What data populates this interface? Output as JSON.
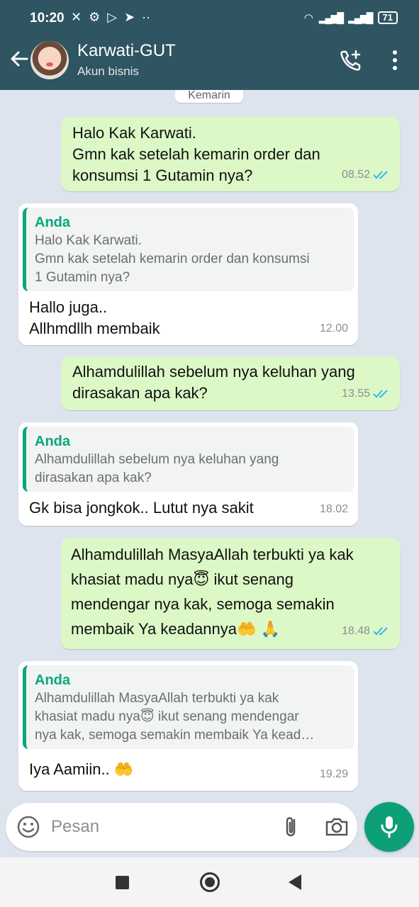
{
  "status_bar": {
    "time": "10:20",
    "battery": "71"
  },
  "header": {
    "title": "Karwati-GUT",
    "subtitle": "Akun bisnis"
  },
  "date_chip": "Kemarin",
  "messages": [
    {
      "direction": "out",
      "text": "Halo Kak Karwati.\nGmn kak setelah kemarin order dan\nkonsumsi 1 Gutamin nya?",
      "time": "08.52",
      "status": "read"
    },
    {
      "direction": "in",
      "quote_author": "Anda",
      "quote_text": "Halo Kak Karwati.\nGmn kak setelah kemarin order dan konsumsi\n1 Gutamin nya?",
      "text": "Hallo juga..\nAllhmdllh membaik",
      "time": "12.00"
    },
    {
      "direction": "out",
      "text": "Alhamdulillah sebelum nya keluhan yang\ndirasakan apa kak?",
      "time": "13.55",
      "status": "read"
    },
    {
      "direction": "in",
      "quote_author": "Anda",
      "quote_text": "Alhamdulillah sebelum nya keluhan yang\ndirasakan apa kak?",
      "text": "Gk bisa jongkok.. Lutut nya sakit",
      "time": "18.02"
    },
    {
      "direction": "out",
      "text": "Alhamdulillah MasyaAllah terbukti ya kak\nkhasiat madu nya😇 ikut senang\nmendengar nya kak, semoga semakin\nmembaik Ya keadannya🤲 🙏",
      "time": "18.48",
      "status": "read"
    },
    {
      "direction": "in",
      "quote_author": "Anda",
      "quote_text": "Alhamdulillah MasyaAllah terbukti ya kak\nkhasiat madu nya😇 ikut senang mendengar\nnya kak, semoga semakin membaik Ya kead…",
      "text": "Iya Aamiin.. 🤲",
      "time": "19.29"
    }
  ],
  "input": {
    "placeholder": "Pesan"
  },
  "colors": {
    "header": "#2e5561",
    "outgoing": "#dcf8c6",
    "incoming": "#ffffff",
    "accent": "#0d9f77",
    "tick_read": "#34b7f1"
  },
  "icons": {
    "back": "arrow-left-icon",
    "call": "add-call-icon",
    "menu": "more-vert-icon",
    "emoji": "emoji-icon",
    "attach": "paperclip-icon",
    "camera": "camera-icon",
    "mic": "mic-icon"
  }
}
